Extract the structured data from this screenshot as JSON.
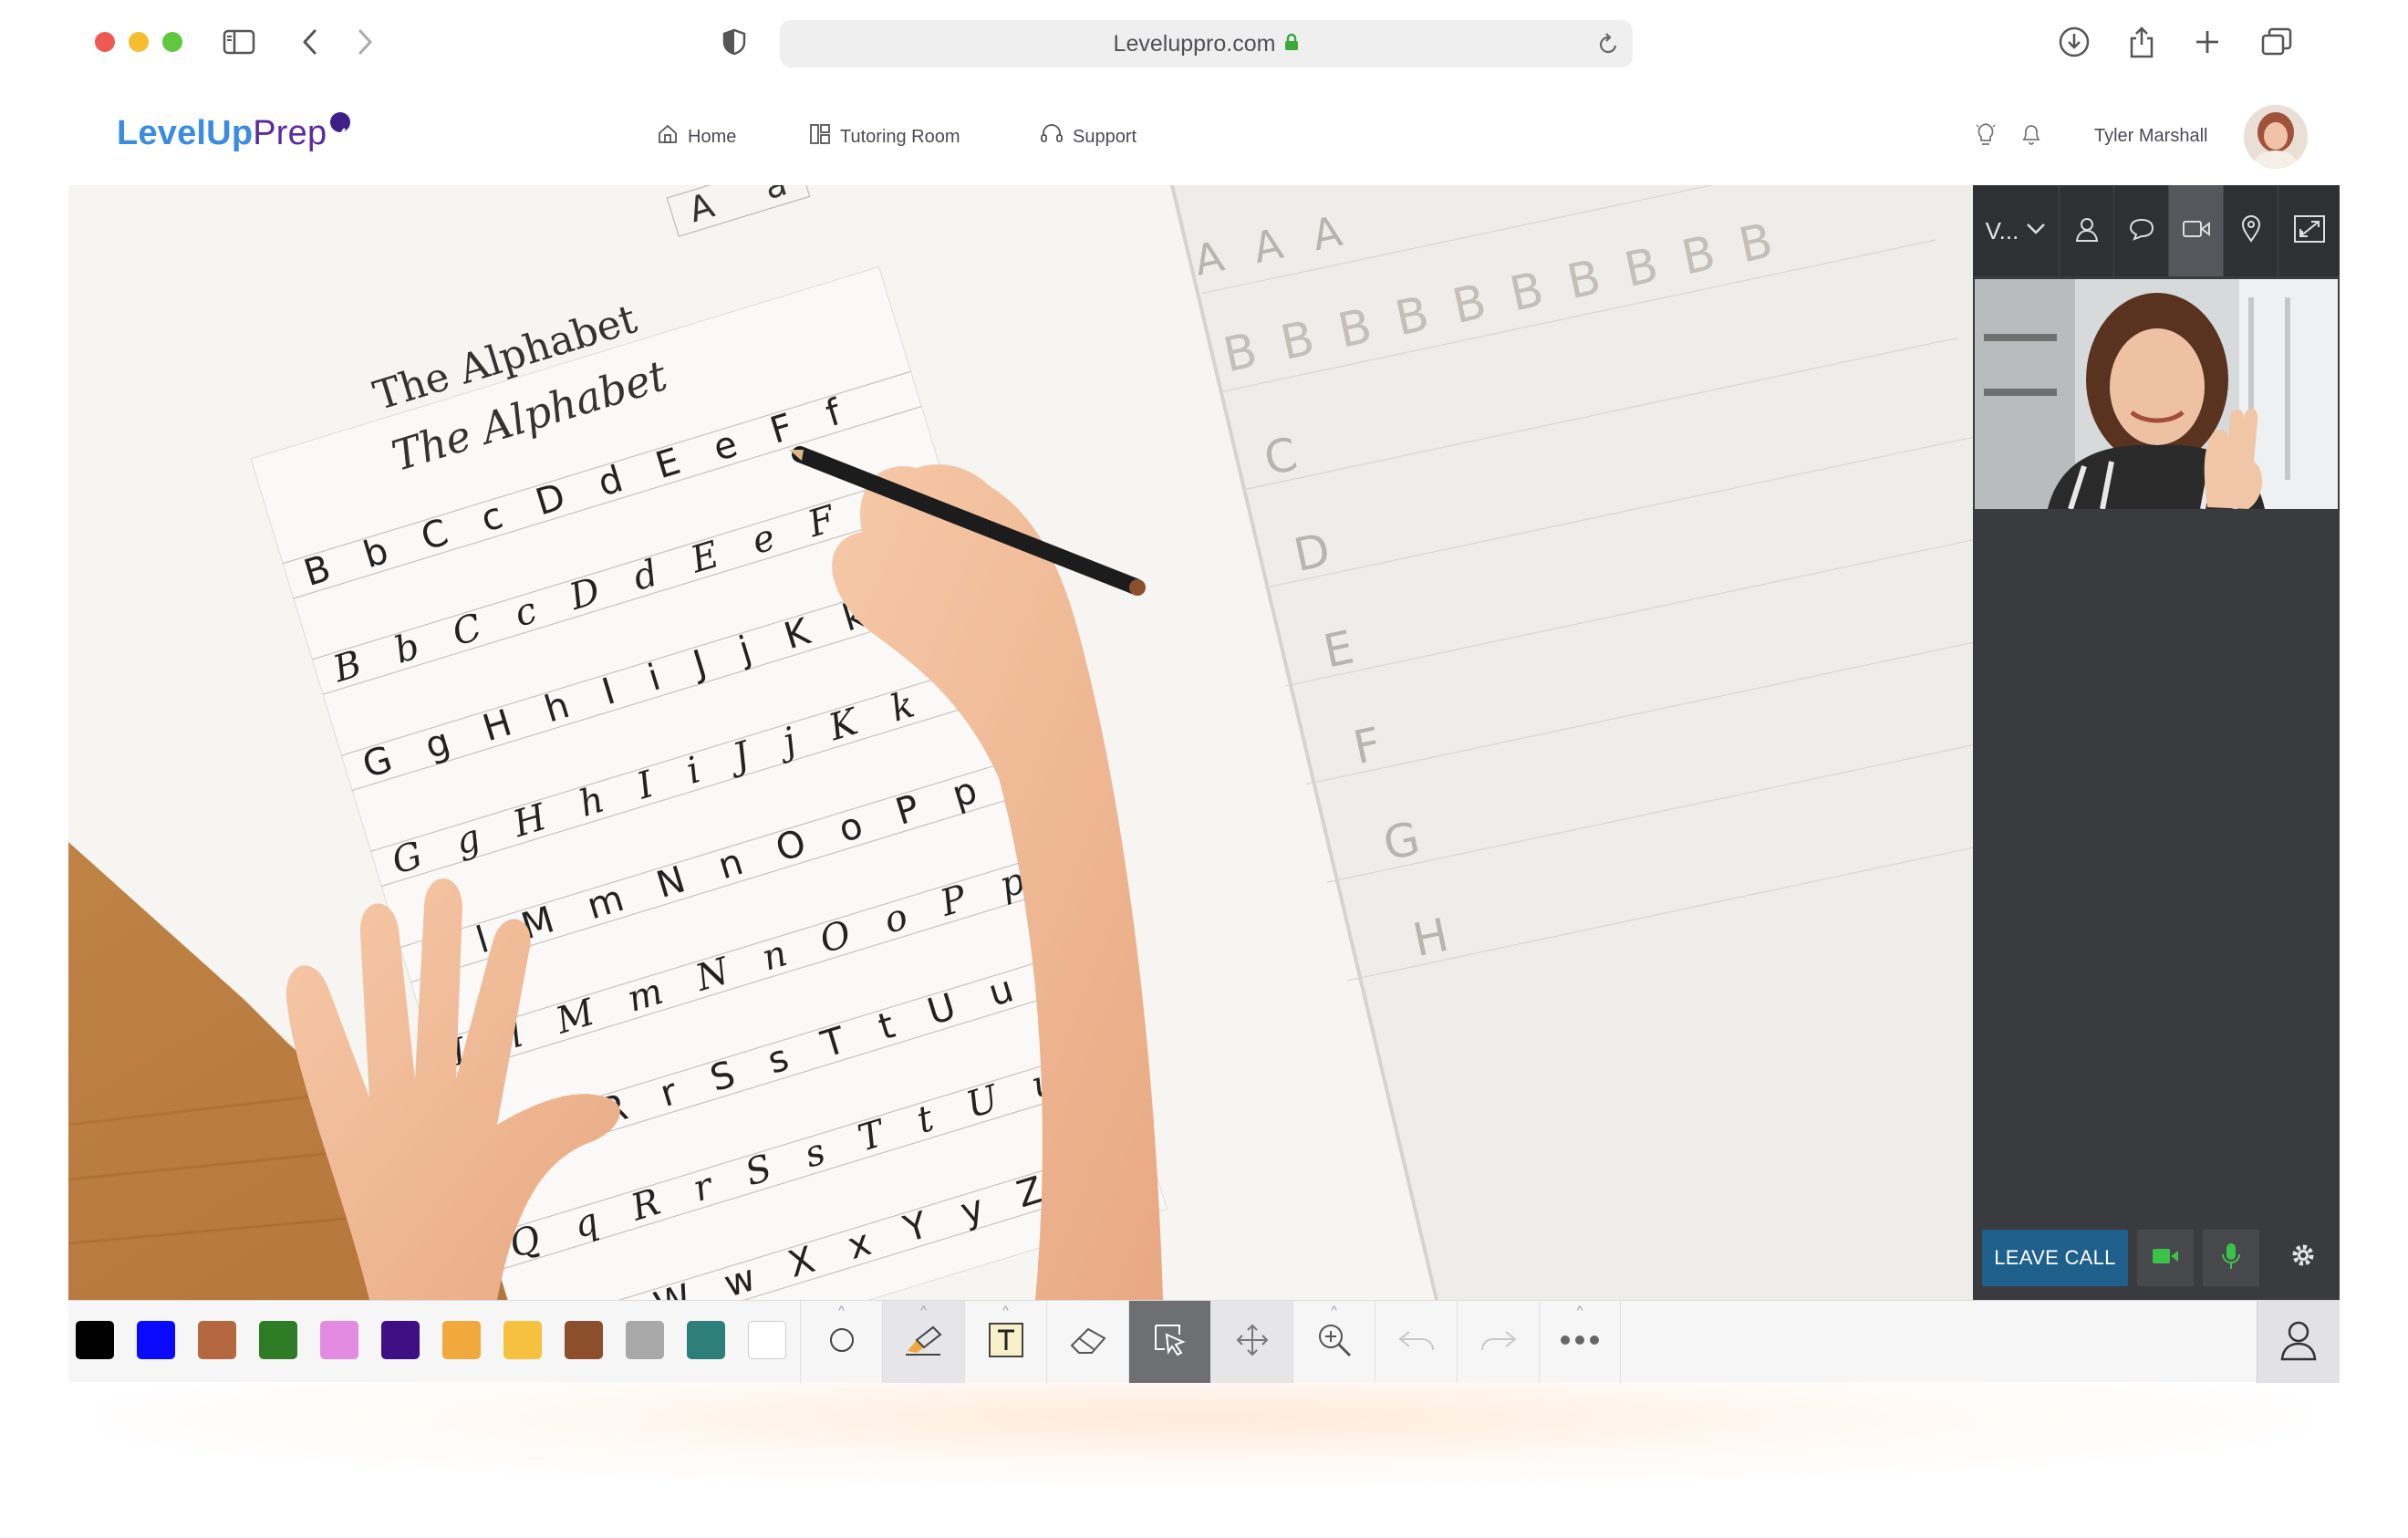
{
  "browser": {
    "url": "Leveluppro.com",
    "icons": [
      "sidebar-icon",
      "back-icon",
      "forward-icon",
      "shield-icon",
      "lock-icon",
      "reload-icon",
      "download-icon",
      "share-icon",
      "new-tab-icon",
      "tabs-icon"
    ]
  },
  "header": {
    "logo_level": "LevelUp",
    "logo_prep": "Prep",
    "nav": [
      {
        "label": "Home",
        "icon": "home-icon"
      },
      {
        "label": "Tutoring Room",
        "icon": "grid-icon"
      },
      {
        "label": "Support",
        "icon": "headset-icon"
      }
    ],
    "user_name": "Tyler Marshall",
    "icons": [
      "lightbulb-icon",
      "bell-icon"
    ]
  },
  "worksheet": {
    "title_print": "The Alphabet",
    "title_cursive": "The Alphabet",
    "rows": [
      "B b C c D d E e F f",
      "G g H h I i J j K k",
      "L l M m N n O o P p",
      "Q q R r S s T t U u",
      "V v W w X x Y y Z z"
    ],
    "right_page": [
      "A A A",
      "B B B B B B B B B B",
      "C",
      "D",
      "E",
      "F",
      "G",
      "H"
    ],
    "sample_upper": "A",
    "sample_lower": "a"
  },
  "panel": {
    "view_label": "V...",
    "tabs": [
      "person-icon",
      "chat-icon",
      "video-icon",
      "location-icon"
    ],
    "active_tab": "video-icon",
    "leave_label": "LEAVE CALL",
    "accent": "#1f5f8c",
    "status_green": "#3cc24a"
  },
  "toolbar": {
    "colors": [
      "#000000",
      "#0a0aff",
      "#b5683f",
      "#2e7d26",
      "#e38be0",
      "#3d0f82",
      "#f1a83c",
      "#f6c13f",
      "#8b4f2c",
      "#a8a8a8",
      "#2e7f7c",
      "#ffffff"
    ],
    "tools": [
      "circle-icon",
      "highlighter-icon",
      "text-icon",
      "eraser-icon",
      "select-icon",
      "move-icon",
      "zoom-icon",
      "undo-icon",
      "redo-icon",
      "more-icon"
    ],
    "active_tool": "select-icon"
  }
}
